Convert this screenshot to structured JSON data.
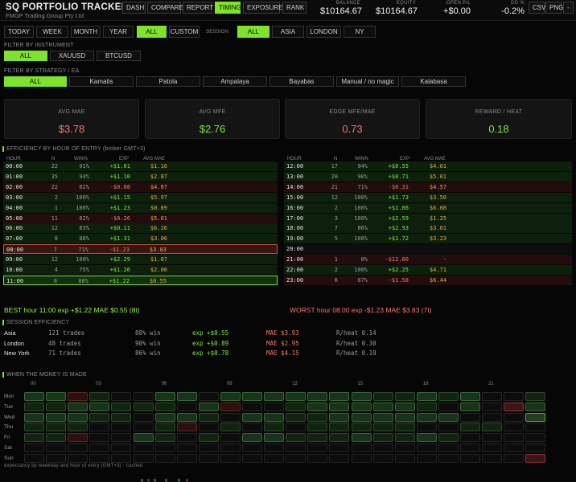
{
  "app": {
    "title": "SQ  PORTFOLIO TRACKER",
    "subtitle": "FMGP Trading Group Pty Ltd"
  },
  "nav": [
    "DASH",
    "COMPARE",
    "REPORT",
    "TIMING",
    "EXPOSURE",
    "RANK"
  ],
  "nav_active": "TIMING",
  "stats": {
    "balance": {
      "label": "BALANCE",
      "value": "$10164.67"
    },
    "equity": {
      "label": "EQUITY",
      "value": "$10164.67"
    },
    "open_pl": {
      "label": "OPEN P/L",
      "value": "+$0.00"
    },
    "dd": {
      "label": "DD %",
      "value": "-0.2%"
    }
  },
  "tools": {
    "csv": "CSV",
    "png": "PNG",
    "minus": "-"
  },
  "period": [
    "TODAY",
    "WEEK",
    "MONTH",
    "YEAR",
    "ALL",
    "CUSTOM"
  ],
  "session_label": "SESSION",
  "sessions": [
    "ALL",
    "ASIA",
    "LONDON",
    "NY"
  ],
  "filter_instrument": {
    "label": "FILTER BY INSTRUMENT",
    "options": [
      "ALL",
      "XAUUSD",
      "BTCUSD"
    ]
  },
  "filter_strategy": {
    "label": "FILTER BY STRATEGY / EA",
    "options": [
      "ALL",
      "Kamatis",
      "Patola",
      "Ampalaya",
      "Bayabas",
      "Manual / no magic",
      "Kalabasa"
    ]
  },
  "cards": [
    {
      "label": "AVG MAE",
      "value": "$3.78",
      "color": "#f07a6a"
    },
    {
      "label": "AVG MFE",
      "value": "$2.76",
      "color": "#79e842"
    },
    {
      "label": "EDGE  MFE/MAE",
      "value": "0.73",
      "color": "#f07a6a"
    },
    {
      "label": "REWARD / HEAT",
      "value": "0.18",
      "color": "#79e842"
    }
  ],
  "efficiency": {
    "title": "EFFICIENCY BY HOUR OF ENTRY  (broker GMT+3)",
    "headers": [
      "HOUR",
      "N",
      "WIN%",
      "EXP",
      "AVG MAE"
    ],
    "left": [
      {
        "h": "00:00",
        "n": "22",
        "w": "91%",
        "e": "+$1.01",
        "m": "$1.16",
        "t": "g"
      },
      {
        "h": "01:00",
        "n": "35",
        "w": "94%",
        "e": "+$1.10",
        "m": "$2.87",
        "t": "g"
      },
      {
        "h": "02:00",
        "n": "22",
        "w": "82%",
        "e": "-$0.08",
        "m": "$4.67",
        "t": "r"
      },
      {
        "h": "03:00",
        "n": "2",
        "w": "100%",
        "e": "+$1.15",
        "m": "$5.97",
        "t": "g"
      },
      {
        "h": "04:00",
        "n": "1",
        "w": "100%",
        "e": "+$1.23",
        "m": "$0.89",
        "t": "g"
      },
      {
        "h": "05:00",
        "n": "11",
        "w": "82%",
        "e": "-$0.26",
        "m": "$5.61",
        "t": "r"
      },
      {
        "h": "06:00",
        "n": "12",
        "w": "83%",
        "e": "+$0.11",
        "m": "$6.26",
        "t": "g"
      },
      {
        "h": "07:00",
        "n": "8",
        "w": "88%",
        "e": "+$1.31",
        "m": "$3.06",
        "t": "g"
      },
      {
        "h": "08:00",
        "n": "7",
        "w": "71%",
        "e": "-$1.23",
        "m": "$3.83",
        "t": "sel-r"
      },
      {
        "h": "09:00",
        "n": "12",
        "w": "100%",
        "e": "+$2.29",
        "m": "$1.07",
        "t": "g"
      },
      {
        "h": "10:00",
        "n": "4",
        "w": "75%",
        "e": "+$1.26",
        "m": "$2.00",
        "t": "g"
      },
      {
        "h": "11:00",
        "n": "8",
        "w": "88%",
        "e": "+$1.22",
        "m": "$0.55",
        "t": "sel-g"
      }
    ],
    "right": [
      {
        "h": "12:00",
        "n": "17",
        "w": "94%",
        "e": "+$0.55",
        "m": "$4.61",
        "t": "g"
      },
      {
        "h": "13:00",
        "n": "20",
        "w": "90%",
        "e": "+$0.71",
        "m": "$5.01",
        "t": "g"
      },
      {
        "h": "14:00",
        "n": "21",
        "w": "71%",
        "e": "-$0.31",
        "m": "$4.57",
        "t": "r"
      },
      {
        "h": "15:00",
        "n": "12",
        "w": "100%",
        "e": "+$1.73",
        "m": "$3.50",
        "t": "g"
      },
      {
        "h": "16:00",
        "n": "2",
        "w": "100%",
        "e": "+$1.06",
        "m": "$6.08",
        "t": "g"
      },
      {
        "h": "17:00",
        "n": "3",
        "w": "100%",
        "e": "+$2.59",
        "m": "$1.25",
        "t": "g"
      },
      {
        "h": "18:00",
        "n": "7",
        "w": "86%",
        "e": "+$2.93",
        "m": "$3.61",
        "t": "g"
      },
      {
        "h": "19:00",
        "n": "5",
        "w": "100%",
        "e": "+$1.72",
        "m": "$3.23",
        "t": "g"
      },
      {
        "h": "20:00",
        "n": "",
        "w": "",
        "e": "",
        "m": "",
        "t": "n"
      },
      {
        "h": "21:00",
        "n": "1",
        "w": "0%",
        "e": "-$12.00",
        "m": "-",
        "t": "r"
      },
      {
        "h": "22:00",
        "n": "2",
        "w": "100%",
        "e": "+$2.25",
        "m": "$4.71",
        "t": "g"
      },
      {
        "h": "23:00",
        "n": "6",
        "w": "67%",
        "e": "-$1.58",
        "m": "$6.44",
        "t": "r"
      }
    ],
    "best": "BEST hour 11:00   exp +$1.22   MAE $0.55   (8t)",
    "worst": "WORST hour 08:00   exp -$1.23   MAE $3.83   (7t)"
  },
  "session_eff": {
    "title": "SESSION EFFICIENCY",
    "rows": [
      {
        "name": "Asia",
        "trades": "121 trades",
        "win": "88% win",
        "exp": "exp +$0.55",
        "mae": "MAE $3.93",
        "rh": "R/heat 0.14"
      },
      {
        "name": "London",
        "trades": "48 trades",
        "win": "90% win",
        "exp": "exp +$0.89",
        "mae": "MAE $2.95",
        "rh": "R/heat 0.30"
      },
      {
        "name": "New York",
        "trades": "71 trades",
        "win": "86% win",
        "exp": "exp +$0.78",
        "mae": "MAE $4.15",
        "rh": "R/heat 0.19"
      }
    ]
  },
  "heatmap": {
    "title": "WHEN THE MONEY IS MADE",
    "hour_labels": [
      "00",
      "03",
      "06",
      "09",
      "12",
      "15",
      "18",
      "21"
    ],
    "days": [
      "Mon",
      "Tue",
      "Wed",
      "Thu",
      "Fri",
      "Sat",
      "Sun"
    ],
    "grid": [
      [
        2,
        2,
        4,
        1,
        0,
        0,
        2,
        2,
        0,
        2,
        2,
        2,
        2,
        2,
        2,
        2,
        1,
        1,
        2,
        1,
        2,
        0,
        0,
        1
      ],
      [
        1,
        1,
        2,
        2,
        1,
        1,
        1,
        0,
        2,
        4,
        0,
        0,
        1,
        2,
        2,
        2,
        2,
        2,
        1,
        0,
        2,
        0,
        5,
        2
      ],
      [
        2,
        2,
        2,
        1,
        1,
        0,
        2,
        2,
        1,
        0,
        2,
        2,
        1,
        1,
        2,
        2,
        2,
        2,
        2,
        2,
        0,
        0,
        0,
        3
      ],
      [
        1,
        1,
        1,
        0,
        0,
        0,
        1,
        4,
        0,
        1,
        0,
        1,
        0,
        1,
        1,
        1,
        1,
        1,
        0,
        0,
        1,
        1,
        0,
        0
      ],
      [
        1,
        1,
        4,
        0,
        0,
        2,
        1,
        0,
        1,
        0,
        2,
        2,
        1,
        1,
        1,
        2,
        1,
        1,
        2,
        1,
        0,
        0,
        0,
        0
      ],
      [
        0,
        0,
        0,
        0,
        0,
        0,
        0,
        0,
        0,
        0,
        0,
        0,
        0,
        0,
        0,
        0,
        0,
        0,
        0,
        0,
        0,
        0,
        0,
        0
      ],
      [
        0,
        0,
        0,
        0,
        0,
        0,
        0,
        0,
        0,
        0,
        0,
        0,
        0,
        0,
        0,
        0,
        0,
        0,
        0,
        0,
        0,
        0,
        0,
        5
      ]
    ],
    "caption": "expectancy by weekday and hour of entry (GMT+3)  ·  cached"
  }
}
